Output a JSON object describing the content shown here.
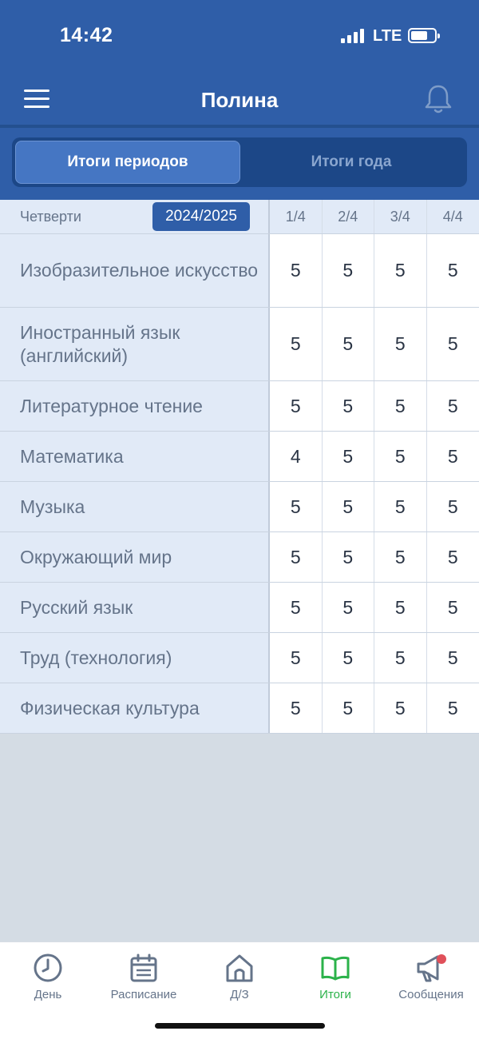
{
  "status": {
    "time": "14:42",
    "network": "LTE"
  },
  "header": {
    "title": "Полина"
  },
  "segments": {
    "active": "Итоги периодов",
    "inactive": "Итоги года"
  },
  "table": {
    "periods_label": "Четверти",
    "year": "2024/2025",
    "columns": [
      "1/4",
      "2/4",
      "3/4",
      "4/4"
    ],
    "rows": [
      {
        "subject": "Изобразительное искусство",
        "grades": [
          "5",
          "5",
          "5",
          "5"
        ]
      },
      {
        "subject": "Иностранный язык (английский)",
        "grades": [
          "5",
          "5",
          "5",
          "5"
        ]
      },
      {
        "subject": "Литературное чтение",
        "grades": [
          "5",
          "5",
          "5",
          "5"
        ]
      },
      {
        "subject": "Математика",
        "grades": [
          "4",
          "5",
          "5",
          "5"
        ]
      },
      {
        "subject": "Музыка",
        "grades": [
          "5",
          "5",
          "5",
          "5"
        ]
      },
      {
        "subject": "Окружающий мир",
        "grades": [
          "5",
          "5",
          "5",
          "5"
        ]
      },
      {
        "subject": "Русский язык",
        "grades": [
          "5",
          "5",
          "5",
          "5"
        ]
      },
      {
        "subject": "Труд (технология)",
        "grades": [
          "5",
          "5",
          "5",
          "5"
        ]
      },
      {
        "subject": "Физическая культура",
        "grades": [
          "5",
          "5",
          "5",
          "5"
        ]
      }
    ]
  },
  "tabbar": {
    "items": [
      {
        "label": "День",
        "icon": "clock-icon"
      },
      {
        "label": "Расписание",
        "icon": "calendar-icon"
      },
      {
        "label": "Д/З",
        "icon": "home-icon"
      },
      {
        "label": "Итоги",
        "icon": "book-icon",
        "active": true
      },
      {
        "label": "Сообщения",
        "icon": "megaphone-icon",
        "badge": true
      }
    ]
  },
  "colors": {
    "primary": "#2f5ea8",
    "active_tab": "#2bb24a",
    "notification": "#e0505a"
  }
}
